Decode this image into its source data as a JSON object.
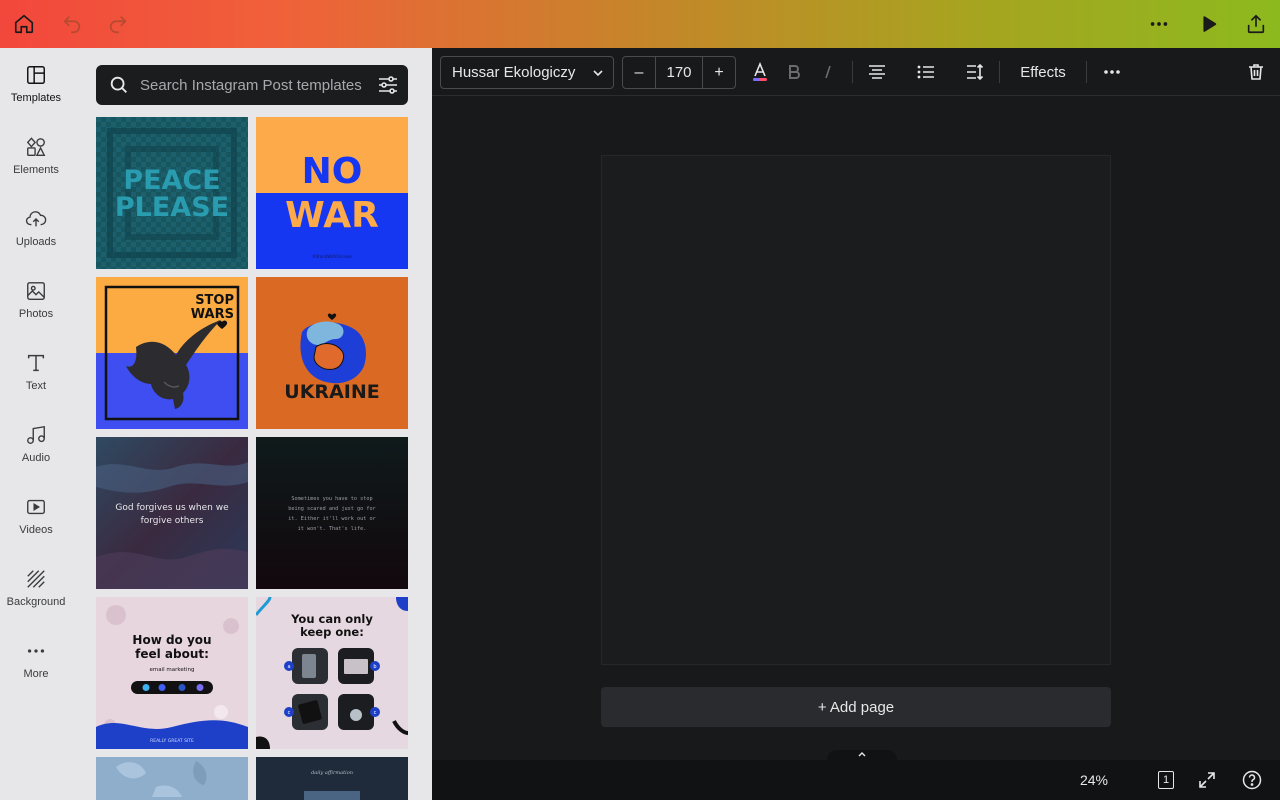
{
  "topbar": {
    "home_icon": "home-icon",
    "undo_icon": "undo-icon",
    "redo_icon": "redo-icon",
    "more_icon": "more-horizontal-icon",
    "present_icon": "play-icon",
    "share_icon": "share-icon"
  },
  "rail": {
    "items": [
      {
        "label": "Templates",
        "icon": "templates-icon"
      },
      {
        "label": "Elements",
        "icon": "elements-icon"
      },
      {
        "label": "Uploads",
        "icon": "upload-icon"
      },
      {
        "label": "Photos",
        "icon": "photos-icon"
      },
      {
        "label": "Text",
        "icon": "text-icon"
      },
      {
        "label": "Audio",
        "icon": "audio-icon"
      },
      {
        "label": "Videos",
        "icon": "video-icon"
      },
      {
        "label": "Background",
        "icon": "background-icon"
      },
      {
        "label": "More",
        "icon": "more-icon"
      }
    ]
  },
  "search": {
    "placeholder": "Search Instagram Post templates"
  },
  "templates": [
    {
      "lines": [
        "PEACE",
        "PLEASE"
      ],
      "bg": "#17555f",
      "fg": "#2a9cb0"
    },
    {
      "lines": [
        "NO",
        "WAR"
      ],
      "caption": "#StandWithUkraine",
      "bg_top": "#fdaa4a",
      "bg_bottom": "#1537f2"
    },
    {
      "lines": [
        "STOP",
        "WARS"
      ],
      "bg_top": "#fcab43",
      "bg_bottom": "#3e4ef0"
    },
    {
      "lines": [
        "UKRAINE"
      ],
      "bg": "#da6a23"
    },
    {
      "lines": [
        "God forgives us when we",
        "forgive others"
      ],
      "bg": "#2a2c40"
    },
    {
      "lines": [
        "Sometimes you have to stop",
        "being scared and just go for",
        "it. Either it'll work out or",
        "it won't. That's life."
      ],
      "bg": "#0e1416"
    },
    {
      "lines": [
        "How do you",
        "feel about:"
      ],
      "sub": "email marketing",
      "footer": "REALLY GREAT SITE",
      "bg": "#e8d6df"
    },
    {
      "lines": [
        "You can only",
        "keep one:"
      ],
      "bg": "#e6d8e0",
      "options": [
        "a",
        "b",
        "c",
        "c"
      ]
    },
    {
      "bg": "#8eaecb"
    },
    {
      "lines": [
        "daily affirmation"
      ],
      "bg": "#1f2a3a"
    }
  ],
  "properties": {
    "font_name": "Hussar Ekologiczy",
    "font_size": "170",
    "decrease_label": "–",
    "increase_label": "+",
    "effects_label": "Effects"
  },
  "canvas": {
    "add_page_label": "+ Add page"
  },
  "bottombar": {
    "zoom": "24%",
    "page_count": "1"
  },
  "colors": {
    "accent_dark": "#18191b",
    "panel": "#e7e7e9"
  }
}
